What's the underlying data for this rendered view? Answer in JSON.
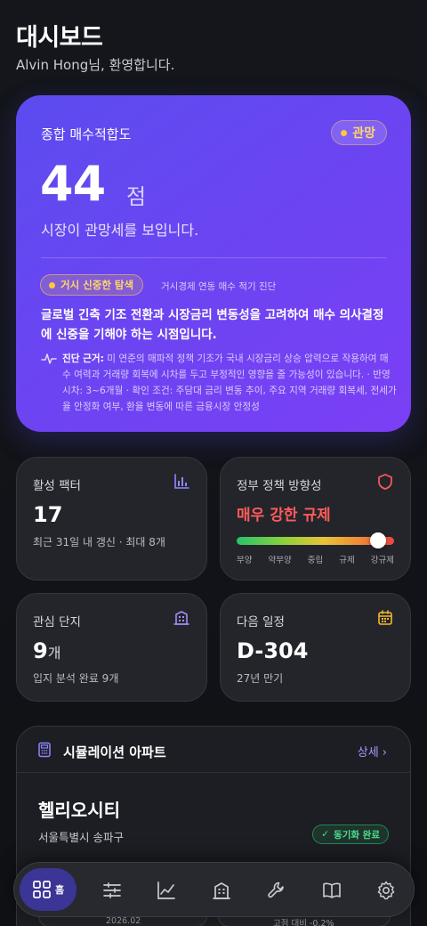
{
  "header": {
    "title": "대시보드",
    "welcome": "Alvin Hong님, 환영합니다."
  },
  "hero": {
    "label": "종합 매수적합도",
    "badge": "관망",
    "score": "44",
    "score_unit": "점",
    "status": "시장이 관망세를 보입니다.",
    "chip": "거시 신중한 탐색",
    "chip_caption": "거시경제 연동 매수 적기 진단",
    "summary": "글로벌 긴축 기조 전환과 시장금리 변동성을 고려하여 매수 의사결정에 신중을 기해야 하는 시점입니다.",
    "basis_label": "진단 근거:",
    "basis_text": " 미 연준의 매파적 정책 기조가 국내 시장금리 상승 압력으로 작용하여 매수 여력과 거래량 회복에 시차를 두고 부정적인 영향을 줄 가능성이 있습니다. · 반영 시차: 3~6개월 · 확인 조건: 주담대 금리 변동 추이, 주요 지역 거래량 회복세, 전세가율 안정화 여부, 환율 변동에 따른 금융시장 안정성"
  },
  "cards": {
    "factors": {
      "title": "활성 팩터",
      "value": "17",
      "sub": "최근 31일 내 갱신 · 최대 8개",
      "icon": "bar-chart-icon"
    },
    "policy": {
      "title": "정부 정책 방향성",
      "value": "매우 강한 규제",
      "level": 0.9,
      "scale": [
        "부양",
        "약부양",
        "중립",
        "규제",
        "강규제"
      ],
      "icon": "shield-icon"
    },
    "watchlist": {
      "title": "관심 단지",
      "value": "9",
      "unit": "개",
      "sub": "입지 분석 완료 9개",
      "icon": "building-icon"
    },
    "schedule": {
      "title": "다음 일정",
      "value": "D-304",
      "sub": "27년 만기",
      "icon": "calendar-icon"
    }
  },
  "simulation": {
    "title": "시뮬레이션 아파트",
    "more": "상세 ›",
    "apartment": "헬리오시티",
    "location": "서울특별시 송파구",
    "sync": "동기화 완료",
    "foot_left": "2026.02",
    "foot_right": "고점 대비 -0.2%"
  },
  "nav": {
    "home": "홈"
  },
  "colors": {
    "accent": "#6a45f1",
    "danger": "#ff5b5b",
    "success": "#4ee08f",
    "warning": "#ffd76a"
  }
}
